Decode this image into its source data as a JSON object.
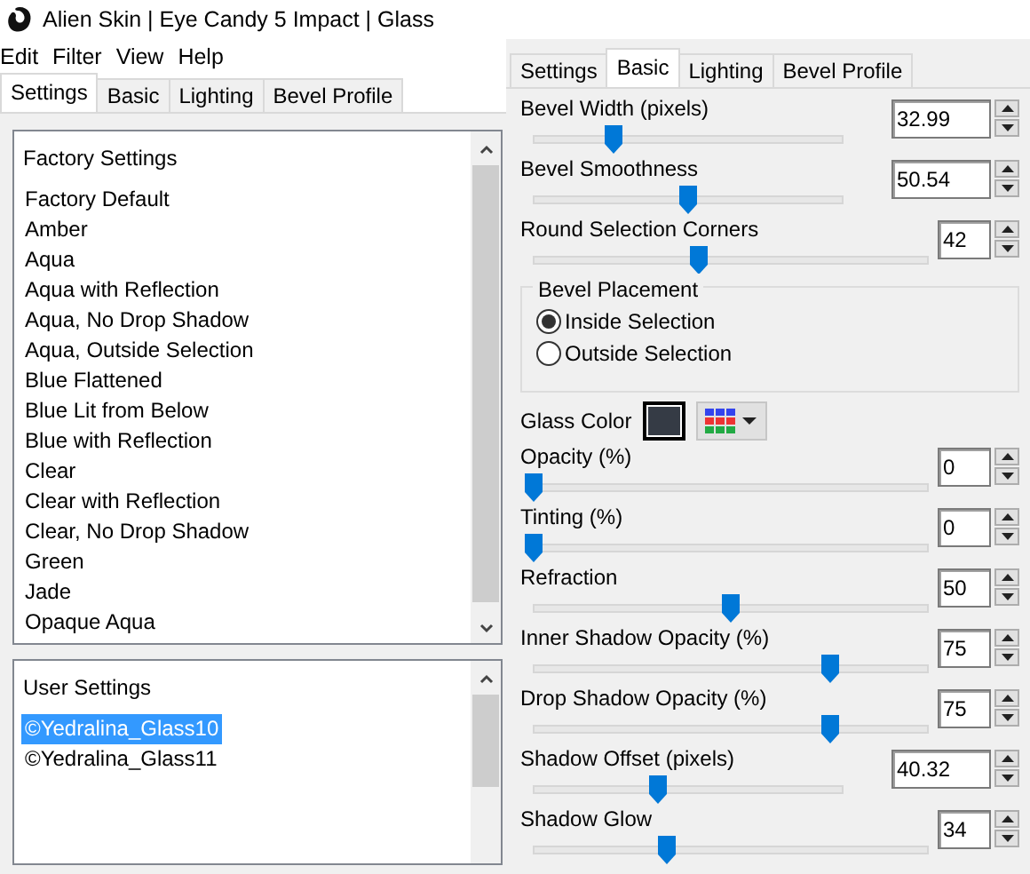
{
  "window": {
    "title": "Alien Skin | Eye Candy 5 Impact | Glass"
  },
  "menu": [
    "Edit",
    "Filter",
    "View",
    "Help"
  ],
  "left_tabs": [
    {
      "label": "Settings",
      "selected": true
    },
    {
      "label": "Basic",
      "selected": false
    },
    {
      "label": "Lighting",
      "selected": false
    },
    {
      "label": "Bevel Profile",
      "selected": false
    }
  ],
  "factory_list": {
    "header": "Factory Settings",
    "items": [
      {
        "label": "Factory Default",
        "selected": false
      },
      {
        "label": "Amber",
        "selected": false
      },
      {
        "label": "Aqua",
        "selected": false
      },
      {
        "label": "Aqua with Reflection",
        "selected": false
      },
      {
        "label": "Aqua, No Drop Shadow",
        "selected": false
      },
      {
        "label": "Aqua, Outside Selection",
        "selected": false
      },
      {
        "label": "Blue Flattened",
        "selected": false
      },
      {
        "label": "Blue Lit from Below",
        "selected": false
      },
      {
        "label": "Blue with Reflection",
        "selected": false
      },
      {
        "label": "Clear",
        "selected": false
      },
      {
        "label": "Clear with Reflection",
        "selected": false
      },
      {
        "label": "Clear, No Drop Shadow",
        "selected": false
      },
      {
        "label": "Green",
        "selected": false
      },
      {
        "label": "Jade",
        "selected": false
      },
      {
        "label": "Opaque Aqua",
        "selected": false
      }
    ]
  },
  "user_list": {
    "header": "User Settings",
    "items": [
      {
        "label": "©Yedralina_Glass10",
        "selected": true
      },
      {
        "label": "©Yedralina_Glass11",
        "selected": false
      }
    ]
  },
  "right_tabs": [
    {
      "label": "Settings",
      "selected": false
    },
    {
      "label": "Basic",
      "selected": true
    },
    {
      "label": "Lighting",
      "selected": false
    },
    {
      "label": "Bevel Profile",
      "selected": false
    }
  ],
  "controls": [
    {
      "kind": "slider",
      "label": "Bevel Width (pixels)",
      "value": "32.99",
      "level": 0.26,
      "wide_field": true
    },
    {
      "kind": "slider",
      "label": "Bevel Smoothness",
      "value": "50.54",
      "level": 0.5,
      "wide_field": true
    },
    {
      "kind": "slider",
      "label": "Round Selection Corners",
      "value": "42",
      "level": 0.42,
      "wide_field": false
    },
    {
      "kind": "group",
      "title": "Bevel Placement",
      "options": [
        {
          "label": "Inside Selection",
          "selected": true
        },
        {
          "label": "Outside Selection",
          "selected": false
        }
      ]
    },
    {
      "kind": "color",
      "label": "Glass Color",
      "color": "#353b45"
    },
    {
      "kind": "slider",
      "label": "Opacity (%)",
      "value": "0",
      "level": 0,
      "wide_field": false
    },
    {
      "kind": "slider",
      "label": "Tinting (%)",
      "value": "0",
      "level": 0,
      "wide_field": false
    },
    {
      "kind": "slider",
      "label": "Refraction",
      "value": "50",
      "level": 0.5,
      "wide_field": false
    },
    {
      "kind": "slider",
      "label": "Inner Shadow Opacity (%)",
      "value": "75",
      "level": 0.75,
      "wide_field": false
    },
    {
      "kind": "slider",
      "label": "Drop Shadow Opacity (%)",
      "value": "75",
      "level": 0.75,
      "wide_field": false
    },
    {
      "kind": "slider",
      "label": "Shadow Offset (pixels)",
      "value": "40.32",
      "level": 0.4,
      "wide_field": true
    },
    {
      "kind": "slider",
      "label": "Shadow Glow",
      "value": "34",
      "level": 0.34,
      "wide_field": false
    }
  ]
}
